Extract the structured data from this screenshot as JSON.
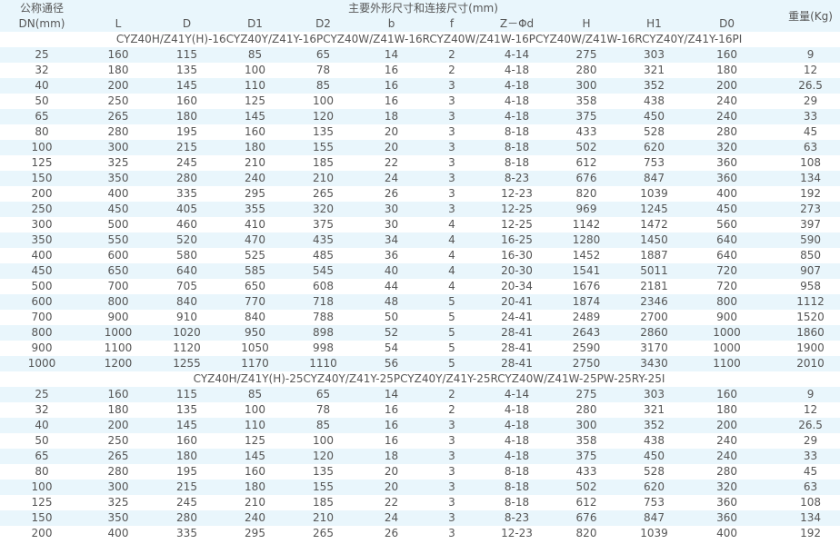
{
  "header": {
    "dn_label_top": "公称通径",
    "dn_label_bottom": "DN(mm)",
    "main_title": "主要外形尺寸和连接尺寸(mm)",
    "weight_label": "重量(Kg)",
    "columns": [
      "L",
      "D",
      "D1",
      "D2",
      "b",
      "f",
      "Z－Φd",
      "H",
      "H1",
      "D0"
    ]
  },
  "groups": [
    {
      "title": "CYZ40H/Z41Y(H)-16CYZ40Y/Z41Y-16PCYZ40W/Z41W-16RCYZ40W/Z41W-16PCYZ40W/Z41W-16RCYZ40Y/Z41Y-16PI",
      "rows": [
        [
          "25",
          "160",
          "115",
          "85",
          "65",
          "14",
          "2",
          "4-14",
          "275",
          "303",
          "160",
          "9"
        ],
        [
          "32",
          "180",
          "135",
          "100",
          "78",
          "16",
          "2",
          "4-18",
          "280",
          "321",
          "180",
          "12"
        ],
        [
          "40",
          "200",
          "145",
          "110",
          "85",
          "16",
          "3",
          "4-18",
          "300",
          "352",
          "200",
          "26.5"
        ],
        [
          "50",
          "250",
          "160",
          "125",
          "100",
          "16",
          "3",
          "4-18",
          "358",
          "438",
          "240",
          "29"
        ],
        [
          "65",
          "265",
          "180",
          "145",
          "120",
          "18",
          "3",
          "4-18",
          "375",
          "450",
          "240",
          "33"
        ],
        [
          "80",
          "280",
          "195",
          "160",
          "135",
          "20",
          "3",
          "8-18",
          "433",
          "528",
          "280",
          "45"
        ],
        [
          "100",
          "300",
          "215",
          "180",
          "155",
          "20",
          "3",
          "8-18",
          "502",
          "620",
          "320",
          "63"
        ],
        [
          "125",
          "325",
          "245",
          "210",
          "185",
          "22",
          "3",
          "8-18",
          "612",
          "753",
          "360",
          "108"
        ],
        [
          "150",
          "350",
          "280",
          "240",
          "210",
          "24",
          "3",
          "8-23",
          "676",
          "847",
          "360",
          "134"
        ],
        [
          "200",
          "400",
          "335",
          "295",
          "265",
          "26",
          "3",
          "12-23",
          "820",
          "1039",
          "400",
          "192"
        ],
        [
          "250",
          "450",
          "405",
          "355",
          "320",
          "30",
          "3",
          "12-25",
          "969",
          "1245",
          "450",
          "273"
        ],
        [
          "300",
          "500",
          "460",
          "410",
          "375",
          "30",
          "4",
          "12-25",
          "1142",
          "1472",
          "560",
          "397"
        ],
        [
          "350",
          "550",
          "520",
          "470",
          "435",
          "34",
          "4",
          "16-25",
          "1280",
          "1450",
          "640",
          "590"
        ],
        [
          "400",
          "600",
          "580",
          "525",
          "485",
          "36",
          "4",
          "16-30",
          "1452",
          "1887",
          "640",
          "850"
        ],
        [
          "450",
          "650",
          "640",
          "585",
          "545",
          "40",
          "4",
          "20-30",
          "1541",
          "5011",
          "720",
          "907"
        ],
        [
          "500",
          "700",
          "705",
          "650",
          "608",
          "44",
          "4",
          "20-34",
          "1676",
          "2181",
          "720",
          "958"
        ],
        [
          "600",
          "800",
          "840",
          "770",
          "718",
          "48",
          "5",
          "20-41",
          "1874",
          "2346",
          "800",
          "1112"
        ],
        [
          "700",
          "900",
          "910",
          "840",
          "788",
          "50",
          "5",
          "24-41",
          "2489",
          "2700",
          "900",
          "1520"
        ],
        [
          "800",
          "1000",
          "1020",
          "950",
          "898",
          "52",
          "5",
          "28-41",
          "2643",
          "2860",
          "1000",
          "1860"
        ],
        [
          "900",
          "1100",
          "1120",
          "1050",
          "998",
          "54",
          "5",
          "28-41",
          "2590",
          "3170",
          "1000",
          "1900"
        ],
        [
          "1000",
          "1200",
          "1255",
          "1170",
          "1110",
          "56",
          "5",
          "28-41",
          "2750",
          "3430",
          "1100",
          "2010"
        ]
      ]
    },
    {
      "title": "CYZ40H/Z41Y(H)-25CYZ40Y/Z41Y-25PCYZ40Y/Z41Y-25RCYZ40W/Z41W-25PW-25RY-25I",
      "rows": [
        [
          "25",
          "160",
          "115",
          "85",
          "65",
          "14",
          "2",
          "4-14",
          "275",
          "303",
          "160",
          "9"
        ],
        [
          "32",
          "180",
          "135",
          "100",
          "78",
          "16",
          "2",
          "4-18",
          "280",
          "321",
          "180",
          "12"
        ],
        [
          "40",
          "200",
          "145",
          "110",
          "85",
          "16",
          "3",
          "4-18",
          "300",
          "352",
          "200",
          "26.5"
        ],
        [
          "50",
          "250",
          "160",
          "125",
          "100",
          "16",
          "3",
          "4-18",
          "358",
          "438",
          "240",
          "29"
        ],
        [
          "65",
          "265",
          "180",
          "145",
          "120",
          "18",
          "3",
          "4-18",
          "375",
          "450",
          "240",
          "33"
        ],
        [
          "80",
          "280",
          "195",
          "160",
          "135",
          "20",
          "3",
          "8-18",
          "433",
          "528",
          "280",
          "45"
        ],
        [
          "100",
          "300",
          "215",
          "180",
          "155",
          "20",
          "3",
          "8-18",
          "502",
          "620",
          "320",
          "63"
        ],
        [
          "125",
          "325",
          "245",
          "210",
          "185",
          "22",
          "3",
          "8-18",
          "612",
          "753",
          "360",
          "108"
        ],
        [
          "150",
          "350",
          "280",
          "240",
          "210",
          "24",
          "3",
          "8-23",
          "676",
          "847",
          "360",
          "134"
        ],
        [
          "200",
          "400",
          "335",
          "295",
          "265",
          "26",
          "3",
          "12-23",
          "820",
          "1039",
          "400",
          "192"
        ]
      ]
    }
  ]
}
